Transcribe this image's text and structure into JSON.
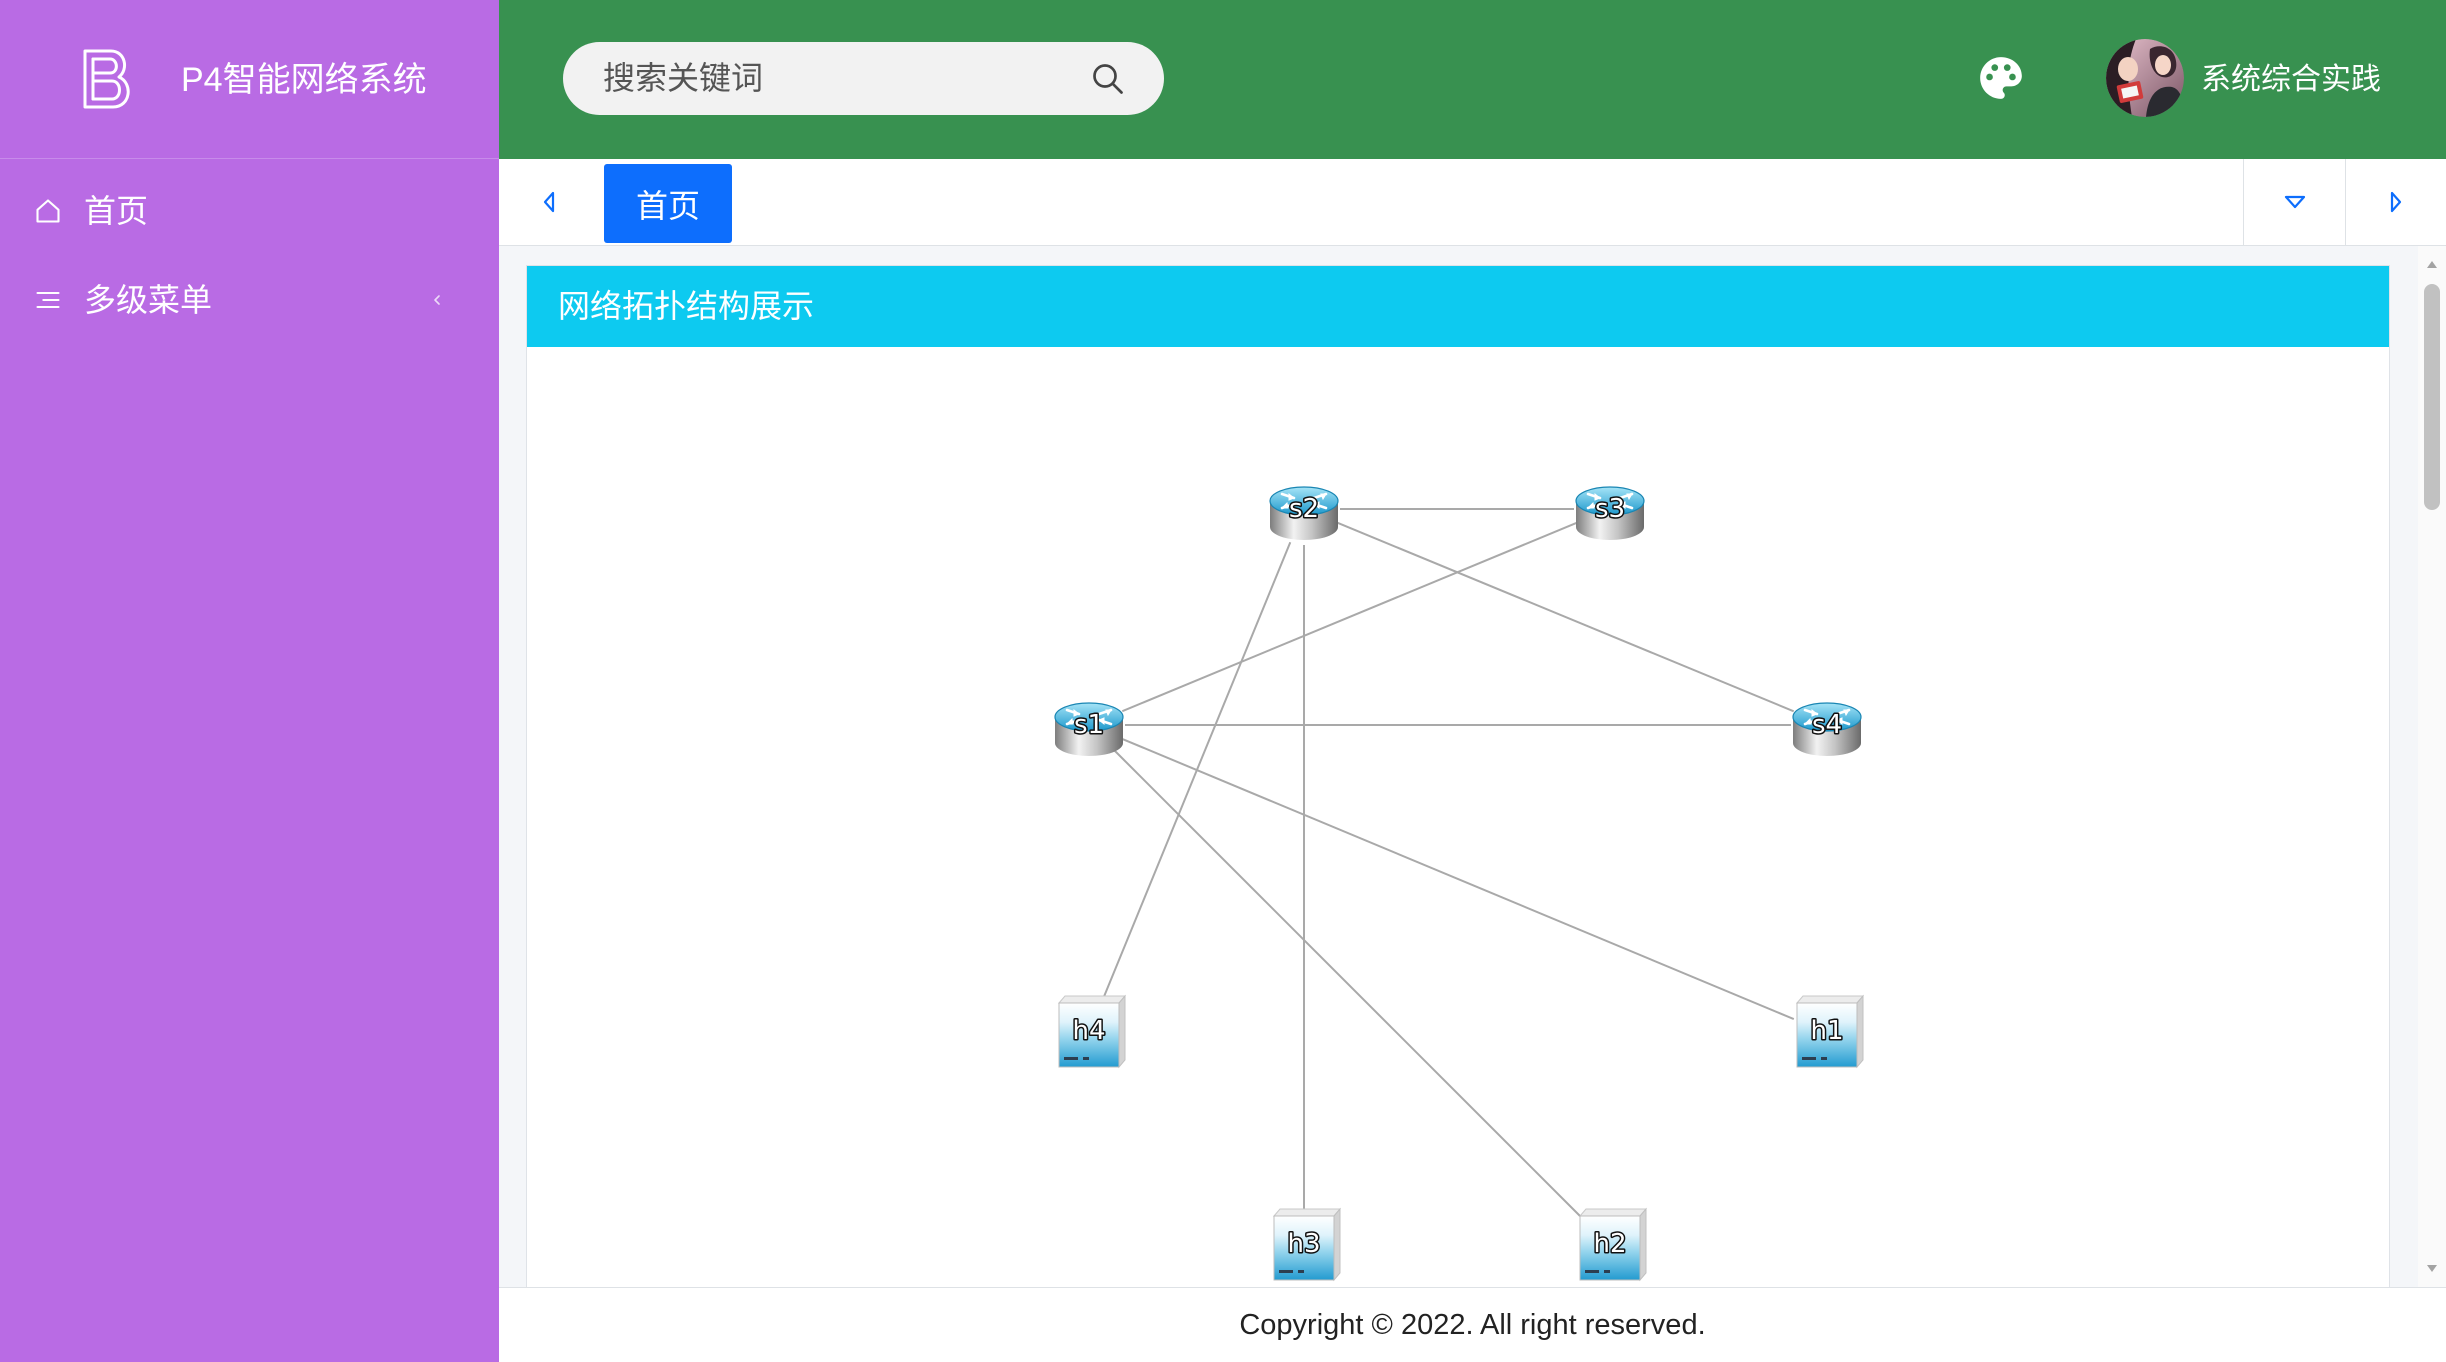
{
  "app": {
    "title": "P4智能网络系统",
    "logo_icon": "brand-logo-icon"
  },
  "sidebar": {
    "items": [
      {
        "label": "首页",
        "icon": "home-icon"
      },
      {
        "label": "多级菜单",
        "icon": "indent-menu-icon",
        "expand_icon": "chevron-left-icon"
      }
    ]
  },
  "header": {
    "search": {
      "placeholder": "搜索关键词",
      "value": "",
      "icon": "search-icon"
    },
    "theme_icon": "palette-icon",
    "user": {
      "name": "系统综合实践",
      "avatar": "user-avatar"
    }
  },
  "tabs": {
    "prev_icon": "caret-left-icon",
    "items": [
      {
        "label": "首页",
        "active": true
      }
    ],
    "dropdown_icon": "caret-down-icon",
    "next_icon": "caret-right-icon"
  },
  "card": {
    "title": "网络拓扑结构展示"
  },
  "topology": {
    "nodes": [
      {
        "label": "s1",
        "icon": "router-icon"
      },
      {
        "label": "s2",
        "icon": "router-icon"
      },
      {
        "label": "s3",
        "icon": "router-icon"
      },
      {
        "label": "s4",
        "icon": "router-icon"
      },
      {
        "label": "h1",
        "icon": "host-icon"
      },
      {
        "label": "h2",
        "icon": "host-icon"
      },
      {
        "label": "h3",
        "icon": "host-icon"
      },
      {
        "label": "h4",
        "icon": "host-icon"
      }
    ],
    "links": [
      [
        1,
        2
      ],
      [
        1,
        3
      ],
      [
        0,
        2
      ],
      [
        0,
        3
      ],
      [
        1,
        7
      ],
      [
        1,
        6
      ],
      [
        0,
        4
      ],
      [
        0,
        5
      ]
    ]
  },
  "footer": {
    "copyright": "Copyright © 2022. All right reserved."
  },
  "theme": {
    "sidebar_bg": "#b96be4",
    "header_bg": "#389150",
    "active_tab_bg": "#0d6efd",
    "card_header_bg": "#0dcaf0"
  }
}
